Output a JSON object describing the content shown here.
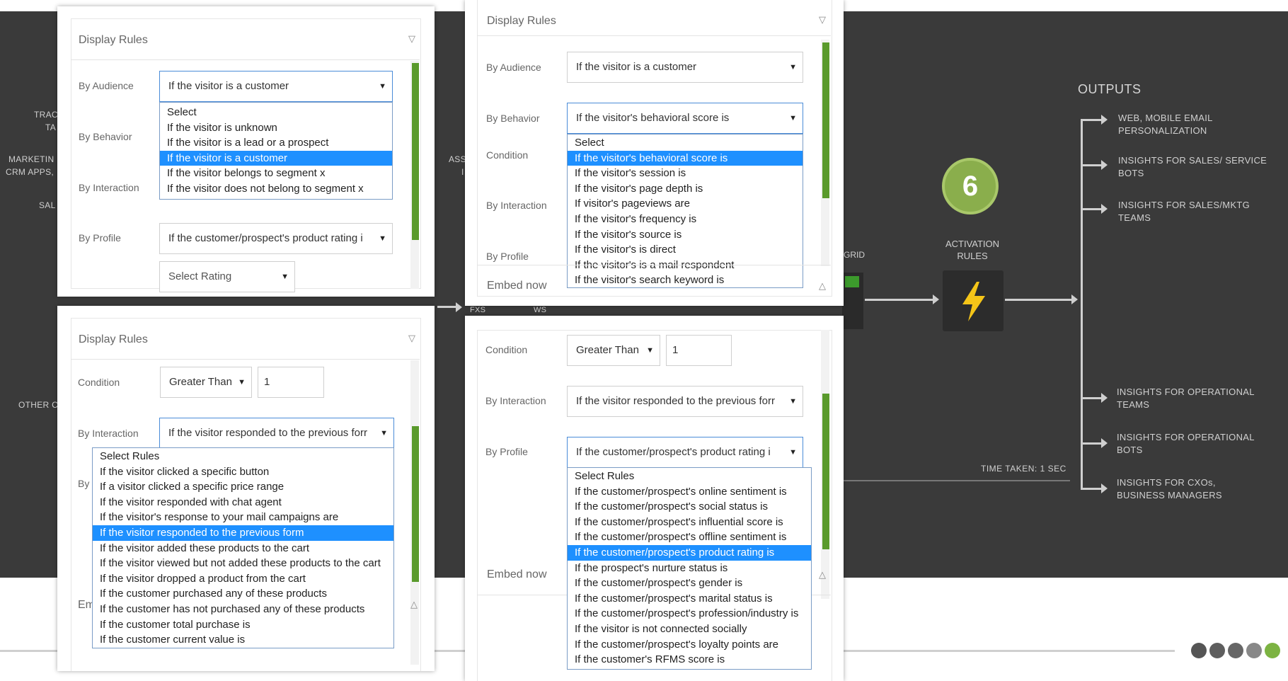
{
  "background": {
    "left_labels": [
      "TRAC",
      "TA",
      "MARKETIN",
      "CRM APPS,",
      "SAL",
      "OTHER C",
      "ASS",
      "I",
      "FXS",
      "WS",
      "P"
    ],
    "grid_label": "GRID",
    "outputs_title": "OUTPUTS",
    "outputs": [
      "WEB,  MOBILE EMAIL PERSONALIZATION",
      "INSIGHTS FOR SALES/ SERVICE BOTS",
      "INSIGHTS FOR SALES/MKTG TEAMS",
      "INSIGHTS FOR OPERATIONAL TEAMS",
      "INSIGHTS FOR OPERATIONAL BOTS",
      "INSIGHTS FOR CXOs,  BUSINESS MANAGERS"
    ],
    "step_number": "6",
    "activation_label": "ACTIVATION RULES",
    "time_taken": "TIME TAKEN: 1 SEC",
    "colors": {
      "dark_bg": "#3a3a3a",
      "badge": "#8aae4c",
      "bolt": "#f5c518",
      "highlight": "#1e90ff",
      "scroll_green": "#5a9a2c"
    }
  },
  "panel1": {
    "title": "Display Rules",
    "labels": {
      "audience": "By Audience",
      "behavior": "By Behavior",
      "interaction": "By Interaction",
      "profile": "By Profile"
    },
    "audience_value": "If the visitor is a customer",
    "audience_options": [
      "Select",
      "If the visitor is unknown",
      "If the visitor is a lead or a prospect",
      "If the visitor is a customer",
      "If the visitor belongs to segment x",
      "If the visitor does not belong to segment x"
    ],
    "profile_value": "If the customer/prospect's product rating i",
    "rating_placeholder": "Select Rating"
  },
  "panel2": {
    "title": "Display Rules",
    "labels": {
      "audience": "By Audience",
      "behavior": "By Behavior",
      "condition": "Condition",
      "interaction": "By Interaction",
      "profile": "By Profile"
    },
    "audience_value": "If the visitor is a customer",
    "behavior_value": "If the visitor's behavioral score is",
    "behavior_options": [
      "Select",
      "If the visitor's behavioral score is",
      "If the visitor's session is",
      "If the visitor's page depth is",
      "If visitor's pageviews are",
      "If the visitor's frequency is",
      "If the visitor's source is",
      "If the visitor's is direct",
      "If the visitor's is a mail respondent",
      "If the visitor's search keyword is"
    ],
    "embed_label": "Embed now"
  },
  "panel3": {
    "title": "Display Rules",
    "labels": {
      "condition": "Condition",
      "interaction": "By Interaction",
      "profile_partial": "By",
      "embed_partial": "Em"
    },
    "condition_value": "Greater Than",
    "condition_number": "1",
    "interaction_value": "If the visitor responded to the previous forr",
    "interaction_options": [
      "Select Rules",
      "If the visitor clicked a specific button",
      "If a visitor clicked a specific price range",
      "If the visitor responded with chat agent",
      "If the visitor's response to your mail campaigns are",
      "If the visitor responded to the previous form",
      "If the visitor added these products to the cart",
      "If the visitor viewed but not added these products to the cart",
      "If the visitor dropped a product from the cart",
      "If the customer purchased any of these products",
      "If the customer has not purchased any of these products",
      "If the customer total purchase is",
      "If the customer current value is"
    ]
  },
  "panel4": {
    "labels": {
      "condition": "Condition",
      "interaction": "By Interaction",
      "profile": "By Profile"
    },
    "condition_value": "Greater Than",
    "condition_number": "1",
    "interaction_value": "If the visitor responded to the previous forr",
    "profile_value": "If the customer/prospect's product rating i",
    "profile_options": [
      "Select Rules",
      "If the customer/prospect's online sentiment is",
      "If the customer/prospect's social status is",
      "If the customer/prospect's influential score is",
      "If the customer/prospect's offline sentiment is",
      "If the customer/prospect's product rating is",
      "If the prospect's nurture status is",
      "If the customer/prospect's gender is",
      "If the customer/prospect's marital status is",
      "If the customer/prospect's profession/industry is",
      "If the visitor is not connected socially",
      "If the customer/prospect's loyalty points are",
      "If the customer's RFMS score is"
    ],
    "embed_label": "Embed now"
  }
}
